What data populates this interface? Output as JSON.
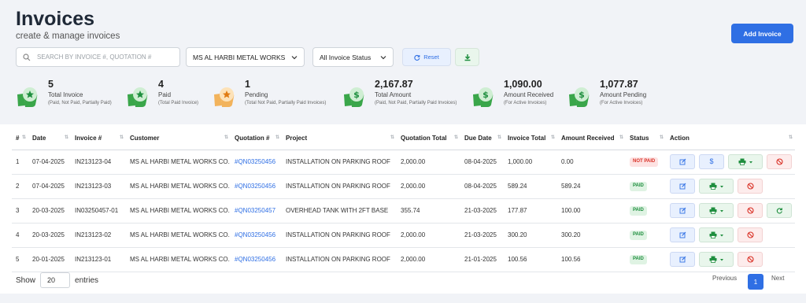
{
  "header": {
    "title": "Invoices",
    "subtitle": "create & manage invoices",
    "add_button": "Add Invoice"
  },
  "filters": {
    "search_placeholder": "SEARCH BY INVOICE #, QUOTATION #",
    "customer_select": "MS AL HARBI METAL WORKS",
    "status_select": "All Invoice Status",
    "reset_label": "Reset"
  },
  "stats": [
    {
      "value": "5",
      "label": "Total Invoice",
      "sub": "(Paid, Not Paid, Partially Paid)",
      "icon": "star-icon",
      "color": "#2e9d3a"
    },
    {
      "value": "4",
      "label": "Paid",
      "sub": "(Total Paid Invoice)",
      "icon": "star-icon",
      "color": "#2e9d3a"
    },
    {
      "value": "1",
      "label": "Pending",
      "sub": "(Total Not Paid, Partially Paid Invoices)",
      "icon": "star-icon",
      "color": "#f0a030"
    },
    {
      "value": "2,167.87",
      "label": "Total Amount",
      "sub": "(Paid, Not Paid, Partially Paid Invoices)",
      "icon": "dollar-icon",
      "color": "#2e9d3a"
    },
    {
      "value": "1,090.00",
      "label": "Amount Received",
      "sub": "(For Active Invoices)",
      "icon": "dollar-icon",
      "color": "#2e9d3a"
    },
    {
      "value": "1,077.87",
      "label": "Amount Pending",
      "sub": "(For Active Invoices)",
      "icon": "dollar-icon",
      "color": "#2e9d3a"
    }
  ],
  "table": {
    "columns": [
      "#",
      "Date",
      "Invoice #",
      "Customer",
      "Quotation #",
      "Project",
      "Quotation Total",
      "Due Date",
      "Invoice Total",
      "Amount Received",
      "Status",
      "Action"
    ],
    "rows": [
      {
        "n": "1",
        "date": "07-04-2025",
        "invoice": "IN213123-04",
        "customer": "MS AL HARBI METAL WORKS CO.",
        "quotation": "#QN03250456",
        "project": "INSTALLATION ON PARKING ROOF",
        "qtotal": "2,000.00",
        "due": "08-04-2025",
        "itotal": "1,000.00",
        "received": "0.00",
        "status": "NOT PAID"
      },
      {
        "n": "2",
        "date": "07-04-2025",
        "invoice": "IN213123-03",
        "customer": "MS AL HARBI METAL WORKS CO.",
        "quotation": "#QN03250456",
        "project": "INSTALLATION ON PARKING ROOF",
        "qtotal": "2,000.00",
        "due": "08-04-2025",
        "itotal": "589.24",
        "received": "589.24",
        "status": "PAID"
      },
      {
        "n": "3",
        "date": "20-03-2025",
        "invoice": "IN03250457-01",
        "customer": "MS AL HARBI METAL WORKS CO.",
        "quotation": "#QN03250457",
        "project": "OVERHEAD TANK WITH 2FT BASE",
        "qtotal": "355.74",
        "due": "21-03-2025",
        "itotal": "177.87",
        "received": "100.00",
        "status": "PAID"
      },
      {
        "n": "4",
        "date": "20-03-2025",
        "invoice": "IN213123-02",
        "customer": "MS AL HARBI METAL WORKS CO.",
        "quotation": "#QN03250456",
        "project": "INSTALLATION ON PARKING ROOF",
        "qtotal": "2,000.00",
        "due": "21-03-2025",
        "itotal": "300.20",
        "received": "300.20",
        "status": "PAID"
      },
      {
        "n": "5",
        "date": "20-01-2025",
        "invoice": "IN213123-01",
        "customer": "MS AL HARBI METAL WORKS CO.",
        "quotation": "#QN03250456",
        "project": "INSTALLATION ON PARKING ROOF",
        "qtotal": "2,000.00",
        "due": "21-01-2025",
        "itotal": "100.56",
        "received": "100.56",
        "status": "PAID"
      }
    ]
  },
  "footer": {
    "show_label": "Show",
    "entries_value": "20",
    "entries_label": "entries",
    "previous": "Previous",
    "page": "1",
    "next": "Next"
  },
  "colors": {
    "accent": "#2f6fe4",
    "paid": "#1e8e3e",
    "unpaid": "#d93025"
  }
}
